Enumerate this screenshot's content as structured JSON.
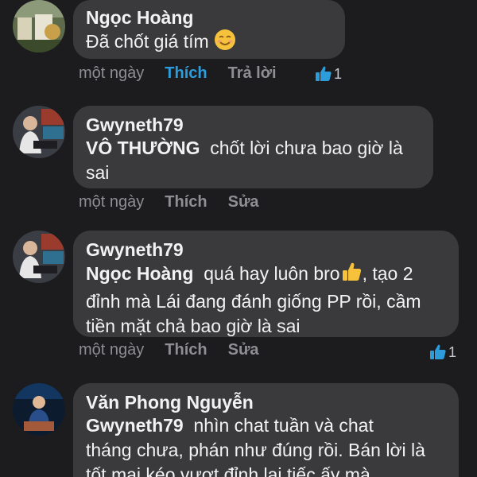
{
  "comments": [
    {
      "author": "Ngọc Hoàng",
      "text": "Đã chốt giá tím",
      "emoji": "smiling-face",
      "time": "một ngày",
      "like_label": "Thích",
      "reply_label": "Trả lời",
      "reaction_count": "1"
    },
    {
      "author": "Gwyneth79",
      "mention": "VÔ THƯỜNG",
      "text_line1": "chốt lời chưa bao giờ là",
      "text_line2": "sai",
      "time": "một ngày",
      "like_label": "Thích",
      "edit_label": "Sửa"
    },
    {
      "author": "Gwyneth79",
      "mention": "Ngọc Hoàng",
      "text_line1a": "quá hay luôn bro",
      "text_line1b": ", tạo 2",
      "text_line2": "đỉnh mà Lái đang đánh giống PP rồi, cầm",
      "text_line3": "tiền mặt chả bao giờ là sai",
      "time": "một ngày",
      "like_label": "Thích",
      "edit_label": "Sửa",
      "reaction_count": "1"
    },
    {
      "author": "Văn Phong Nguyễn",
      "mention": "Gwyneth79",
      "text_line1": "nhìn chat tuần và chat",
      "text_line2": "tháng chưa, phán như đúng rồi. Bán lời là",
      "text_line3": "tốt mai kéo vượt đỉnh lại tiếc ấy mà"
    }
  ],
  "colors": {
    "background": "#1c1c1e",
    "bubble": "#3a3a3c",
    "liked": "#2d9cdb",
    "muted": "#8e8e93"
  }
}
